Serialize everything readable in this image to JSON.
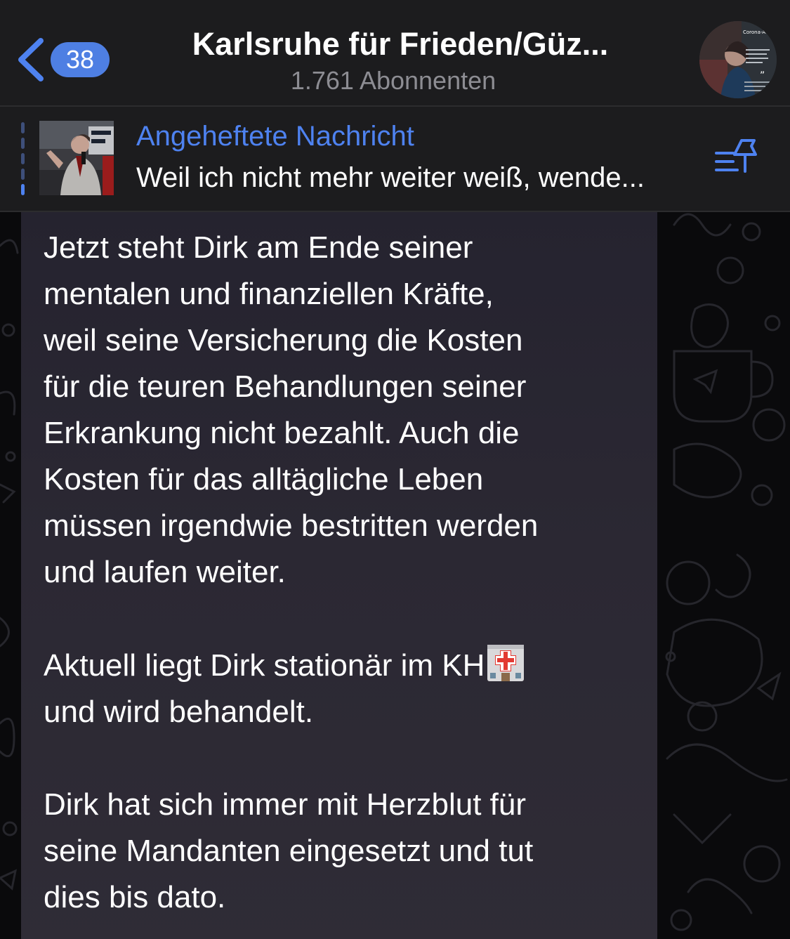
{
  "header": {
    "back_badge": "38",
    "title": "Karlsruhe für Frieden/Güz...",
    "subtitle": "1.761 Abonnenten",
    "avatar_text": "Corona-Aufarb"
  },
  "pinned": {
    "label": "Angeheftete Nachricht",
    "preview": "Weil ich nicht mehr weiter weiß, wende..."
  },
  "message": {
    "p1": "Jetzt steht Dirk am Ende seiner\nmentalen und finanziellen Kräfte,\nweil seine Versicherung die Kosten\nfür die teuren Behandlungen seiner\nErkrankung nicht bezahlt. Auch die\nKosten für das alltägliche Leben\nmüssen irgendwie bestritten werden\nund laufen weiter.",
    "p2_before_emoji": "Aktuell liegt Dirk stationär im KH",
    "p2_after_emoji": "\nund wird behandelt.",
    "p3": "Dirk hat sich immer mit Herzblut für\nseine Mandanten eingesetzt und tut\ndies bis dato."
  },
  "colors": {
    "accent": "#4e82f0",
    "badge": "#4e7fe3",
    "header_bg": "#1c1c1e",
    "bubble_bg": "#2b2833"
  },
  "icons": {
    "back": "chevron-left-icon",
    "pin": "pin-list-icon",
    "emoji": "hospital-emoji"
  }
}
